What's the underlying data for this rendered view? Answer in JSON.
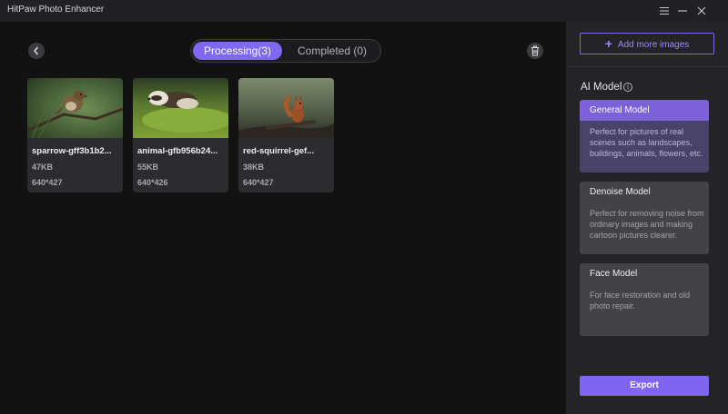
{
  "window": {
    "title": "HitPaw Photo Enhancer"
  },
  "tabs": {
    "processing": "Processing(3)",
    "completed": "Completed (0)"
  },
  "images": [
    {
      "name": "sparrow-gff3b1b2...",
      "size": "47KB",
      "dimensions": "640*427"
    },
    {
      "name": "animal-gfb956b24...",
      "size": "55KB",
      "dimensions": "640*426"
    },
    {
      "name": "red-squirrel-gef...",
      "size": "38KB",
      "dimensions": "640*427"
    }
  ],
  "panel": {
    "add_label": "Add more images",
    "ai_model_label": "AI Model",
    "models": [
      {
        "name": "General Model",
        "description": "Perfect for pictures of real scenes such as landscapes, buildings, animals, flowers, etc."
      },
      {
        "name": "Denoise Model",
        "description": "Perfect for removing noise from ordinary images and making cartoon pictures clearer."
      },
      {
        "name": "Face Model",
        "description": "For face restoration and old photo repair."
      }
    ],
    "export_label": "Export"
  },
  "colors": {
    "accent": "#8068f0",
    "selected_header": "#7b62d9",
    "background": "#121213",
    "panel": "#242427"
  },
  "icons": {
    "back": "chevron-left-icon",
    "trash": "trash-icon",
    "menu": "hamburger-menu-icon",
    "minimize": "minimize-icon",
    "close": "close-icon",
    "info": "info-icon",
    "add": "plus-icon"
  }
}
